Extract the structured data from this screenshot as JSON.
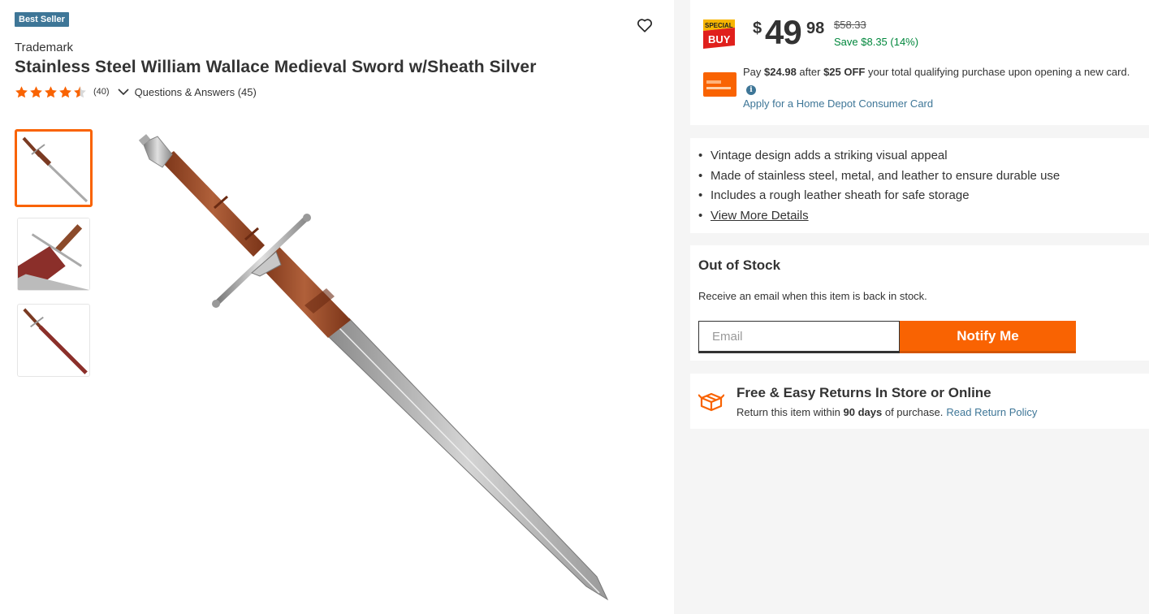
{
  "product": {
    "badge": "Best Seller",
    "brand": "Trademark",
    "title": "Stainless Steel William Wallace Medieval Sword w/Sheath Silver",
    "rating": 4.5,
    "review_count": "(40)",
    "qa_label": "Questions & Answers (45)",
    "selected_thumbnail": 1
  },
  "icons": {
    "wishlist": "heart-icon",
    "rating": "star-icon",
    "expand": "chevron-down-icon",
    "info": "info-icon",
    "returns": "box-icon"
  },
  "price": {
    "special_top": "SPECIAL",
    "special_bottom": "BUY",
    "dollar_sign": "$",
    "dollars": "49",
    "cents": "98",
    "was": "$58.33",
    "save": "Save $8.35 (14%)"
  },
  "promo": {
    "pay_prefix": "Pay",
    "pay_amount": "$24.98",
    "after": "after",
    "off_amount": "$25 OFF",
    "rest": "your total qualifying purchase upon opening a new card.",
    "info_glyph": "i",
    "apply_link": "Apply for a Home Depot Consumer Card"
  },
  "highlights": {
    "items": [
      "Vintage design adds a striking visual appeal",
      "Made of stainless steel, metal, and leather to ensure durable use",
      "Includes a rough leather sheath for safe storage"
    ],
    "more_link": "View More Details"
  },
  "stock": {
    "status": "Out of Stock",
    "message": "Receive an email when this item is back in stock.",
    "email_placeholder": "Email",
    "notify_button": "Notify Me"
  },
  "returns": {
    "title": "Free & Easy Returns In Store or Online",
    "text_prefix": "Return this item within",
    "days": "90 days",
    "text_suffix": "of purchase.",
    "link": "Read Return Policy"
  },
  "colors": {
    "orange": "#f96302",
    "blue": "#3e7697",
    "green": "#00873c"
  }
}
